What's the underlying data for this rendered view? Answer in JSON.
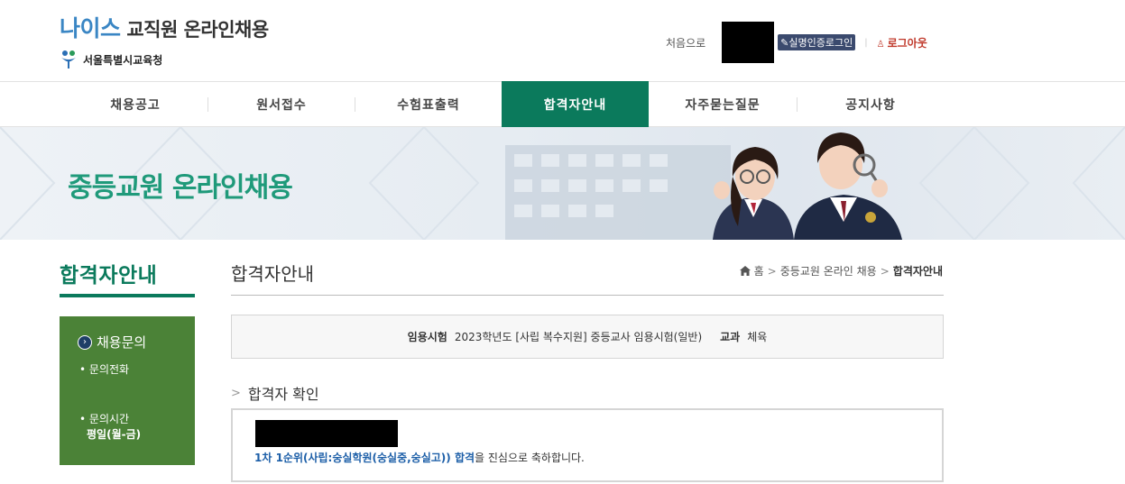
{
  "header": {
    "logo_neis": "나이스",
    "logo_title": "교직원 온라인채용",
    "logo_sub": "서울특별시교육청",
    "home_link": "처음으로",
    "cert_login": "실명인증로그인",
    "logout": "로그아웃"
  },
  "nav": {
    "items": [
      {
        "label": "채용공고"
      },
      {
        "label": "원서접수"
      },
      {
        "label": "수험표출력"
      },
      {
        "label": "합격자안내"
      },
      {
        "label": "자주묻는질문"
      },
      {
        "label": "공지사항"
      }
    ],
    "active": "합격자안내"
  },
  "banner": {
    "title": "중등교원 온라인채용"
  },
  "sidebar": {
    "title": "합격자안내",
    "menu_head": "채용문의",
    "phone_label": "문의전화",
    "hours_label": "문의시간",
    "hours_value": "평일(월-금)"
  },
  "content": {
    "title": "합격자안내",
    "breadcrumb": [
      "홈",
      "중등교원 온라인 채용",
      "합격자안내"
    ],
    "exam_label": "임용시험",
    "exam_value": "2023학년도 [사립 복수지원] 중등교사 임용시험(일반)",
    "subject_label": "교과",
    "subject_value": "체육",
    "section_title": "합격자 확인",
    "result_highlight": "1차 1순위(사립:숭실학원(숭실중,숭실고)) 합격",
    "result_suffix": "을 진심으로 축하합니다."
  },
  "colors": {
    "brand_green": "#0b7a5c",
    "sidebar_green": "#4b8237",
    "banner_text": "#1f9a7a",
    "logout_red": "#c0392b",
    "highlight_blue": "#1d5fa8"
  }
}
